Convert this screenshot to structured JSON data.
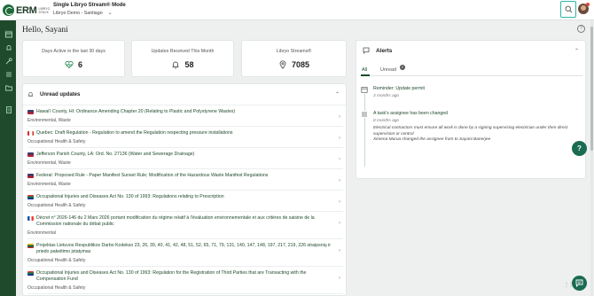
{
  "app": {
    "logo_text": "ERM",
    "logo_sub": "LIBRYO STACK",
    "workspace_mode": "Single Libryo Stream® Mode",
    "workspace_selected": "Libryo Demo - Santiago"
  },
  "page": {
    "greeting": "Hello, Sayani"
  },
  "stats": [
    {
      "label": "Days Active in the last 30 days",
      "value": "6",
      "icon": "heart-pulse-icon"
    },
    {
      "label": "Updates Received This Month",
      "value": "58",
      "icon": "bell-icon"
    },
    {
      "label": "Libryo Streams®",
      "value": "7085",
      "icon": "map-pin-icon"
    }
  ],
  "unread": {
    "title": "Unread updates",
    "items": [
      {
        "flag": "us",
        "title": "Hawai'i County, HI: Ordinance Amending Chapter 20 (Relating to Plastic and Polystyrene Wastes)",
        "tag": "Environmental, Waste"
      },
      {
        "flag": "ca",
        "title": "Quebec: Draft Regulation - Regulation to amend the Regulation respecting pressure installations",
        "tag": "Occupational Health & Safety"
      },
      {
        "flag": "us",
        "title": "Jefferson Parish County, LA: Ord. No. 27136 (Water and Sewerage Drainage)",
        "tag": "Environmental, Waste"
      },
      {
        "flag": "us",
        "title": "Federal: Proposed Rule - Paper Manifest Sunset Rule; Modification of the Hazardous Waste Manifest Regulations",
        "tag": "Environmental, Waste"
      },
      {
        "flag": "za",
        "title": "Occupational Injuries and Diseases Act No. 130 of 1993: Regulations relating to Prescription",
        "tag": "Occupational Health & Safety"
      },
      {
        "flag": "fr",
        "title": "Décret n° 2026-146 du 2 Mars 2026 portant modification du régime relatif à l'évaluation environnementale et aux critères de saisine de la Commission nationale du débat public",
        "tag": "Environmental"
      },
      {
        "flag": "lt",
        "title": "Projektas Lietuvos Respublikos Darbo Kodekso 23, 26, 39, 40, 41, 42, 48, 51, 52, 65, 71, 79, 131, 140, 147, 148, 197, 217, 219, 226 straipsnių ir priedo pakeitimo įstatymas",
        "tag": "Occupational Health & Safety"
      },
      {
        "flag": "za",
        "title": "Occupational Injuries and Diseases Act No. 130 of 1993: Regulation for the Registration of Third Parties that are Transacting with the Compensation Fund",
        "tag": "Occupational Health & Safety"
      }
    ]
  },
  "alerts": {
    "title": "Alerts",
    "tabs": [
      {
        "label": "All"
      },
      {
        "label": "Unread",
        "badge": "2"
      }
    ],
    "items": [
      {
        "icon": "calendar-icon",
        "title": "Reminder: Update permit",
        "time": "3 months ago",
        "body": ""
      },
      {
        "icon": "task-list-icon",
        "title": "A task's assignee has been changed",
        "time": "8 months ago",
        "body": "Electrical contractors must ensure all work is done by a signing supervising electrician under their direct supervision or control",
        "body2": "Ximena Murua changed the assignee from to Sayani Banerjee"
      }
    ]
  },
  "colors": {
    "brand_green": "#1f4a2c",
    "accent_teal": "#2fb7a8",
    "fab": "#1a6b52"
  }
}
